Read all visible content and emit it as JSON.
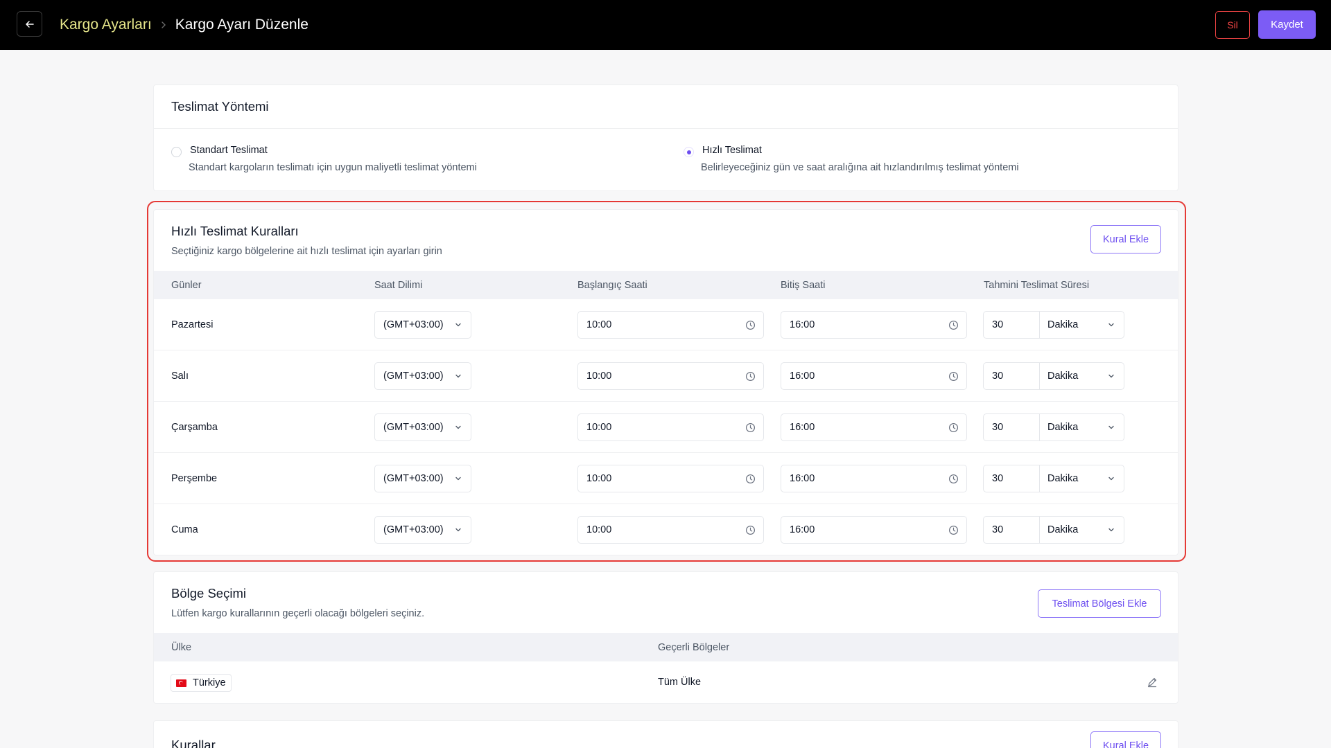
{
  "header": {
    "breadcrumb_parent": "Kargo Ayarları",
    "breadcrumb_current": "Kargo Ayarı Düzenle",
    "delete_label": "Sil",
    "save_label": "Kaydet"
  },
  "delivery_method": {
    "title": "Teslimat Yöntemi",
    "options": [
      {
        "label": "Standart Teslimat",
        "description": "Standart kargoların teslimatı için uygun maliyetli teslimat yöntemi",
        "selected": false
      },
      {
        "label": "Hızlı Teslimat",
        "description": "Belirleyeceğiniz gün ve saat aralığına ait hızlandırılmış teslimat yöntemi",
        "selected": true
      }
    ]
  },
  "fast_rules": {
    "title": "Hızlı Teslimat Kuralları",
    "subtitle": "Seçtiğiniz kargo bölgelerine ait hızlı teslimat için ayarları girin",
    "add_label": "Kural Ekle",
    "columns": [
      "Günler",
      "Saat Dilimi",
      "Başlangıç Saati",
      "Bitiş Saati",
      "Tahmini Teslimat Süresi"
    ],
    "rows": [
      {
        "day": "Pazartesi",
        "timezone": "(GMT+03:00)",
        "start": "10:00",
        "end": "16:00",
        "duration": "30",
        "unit": "Dakika"
      },
      {
        "day": "Salı",
        "timezone": "(GMT+03:00)",
        "start": "10:00",
        "end": "16:00",
        "duration": "30",
        "unit": "Dakika"
      },
      {
        "day": "Çarşamba",
        "timezone": "(GMT+03:00)",
        "start": "10:00",
        "end": "16:00",
        "duration": "30",
        "unit": "Dakika"
      },
      {
        "day": "Perşembe",
        "timezone": "(GMT+03:00)",
        "start": "10:00",
        "end": "16:00",
        "duration": "30",
        "unit": "Dakika"
      },
      {
        "day": "Cuma",
        "timezone": "(GMT+03:00)",
        "start": "10:00",
        "end": "16:00",
        "duration": "30",
        "unit": "Dakika"
      }
    ]
  },
  "region": {
    "title": "Bölge Seçimi",
    "subtitle": "Lütfen kargo kurallarının geçerli olacağı bölgeleri seçiniz.",
    "add_label": "Teslimat Bölgesi Ekle",
    "columns": [
      "Ülke",
      "Geçerli Bölgeler"
    ],
    "rows": [
      {
        "country": "Türkiye",
        "regions": "Tüm Ülke"
      }
    ]
  },
  "rules": {
    "title": "Kurallar",
    "add_label": "Kural Ekle"
  },
  "colors": {
    "accent": "#6d4ef0",
    "danger": "#ef4444",
    "breadcrumb_link": "#e5e58a",
    "highlight": "#e53935"
  }
}
